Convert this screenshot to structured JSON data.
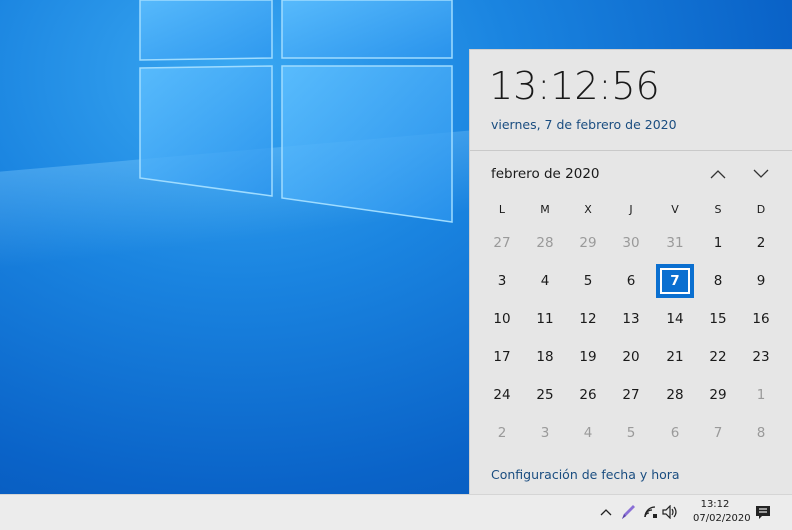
{
  "flyout": {
    "time": "13:12:56",
    "date_long": "viernes, 7 de febrero de 2020",
    "month_label": "febrero de 2020",
    "settings_link": "Configuración de fecha y hora"
  },
  "calendar": {
    "weekdays": [
      "L",
      "M",
      "X",
      "J",
      "V",
      "S",
      "D"
    ],
    "weeks": [
      [
        "27",
        "28",
        "29",
        "30",
        "31",
        "1",
        "2"
      ],
      [
        "3",
        "4",
        "5",
        "6",
        "7",
        "8",
        "9"
      ],
      [
        "10",
        "11",
        "12",
        "13",
        "14",
        "15",
        "16"
      ],
      [
        "17",
        "18",
        "19",
        "20",
        "21",
        "22",
        "23"
      ],
      [
        "24",
        "25",
        "26",
        "27",
        "28",
        "29",
        "1"
      ],
      [
        "2",
        "3",
        "4",
        "5",
        "6",
        "7",
        "8"
      ]
    ],
    "selected_day": "7"
  },
  "taskbar": {
    "clock_time": "13:12",
    "clock_date": "07/02/2020",
    "tray_icons": [
      "chevron-up-icon",
      "pen-icon",
      "wifi-icon",
      "volume-icon",
      "notification-icon"
    ]
  },
  "colors": {
    "accent": "#0a6fd0",
    "link": "#1a4d80",
    "flyout_bg": "#e6e6e6",
    "taskbar_bg": "#ececec"
  }
}
